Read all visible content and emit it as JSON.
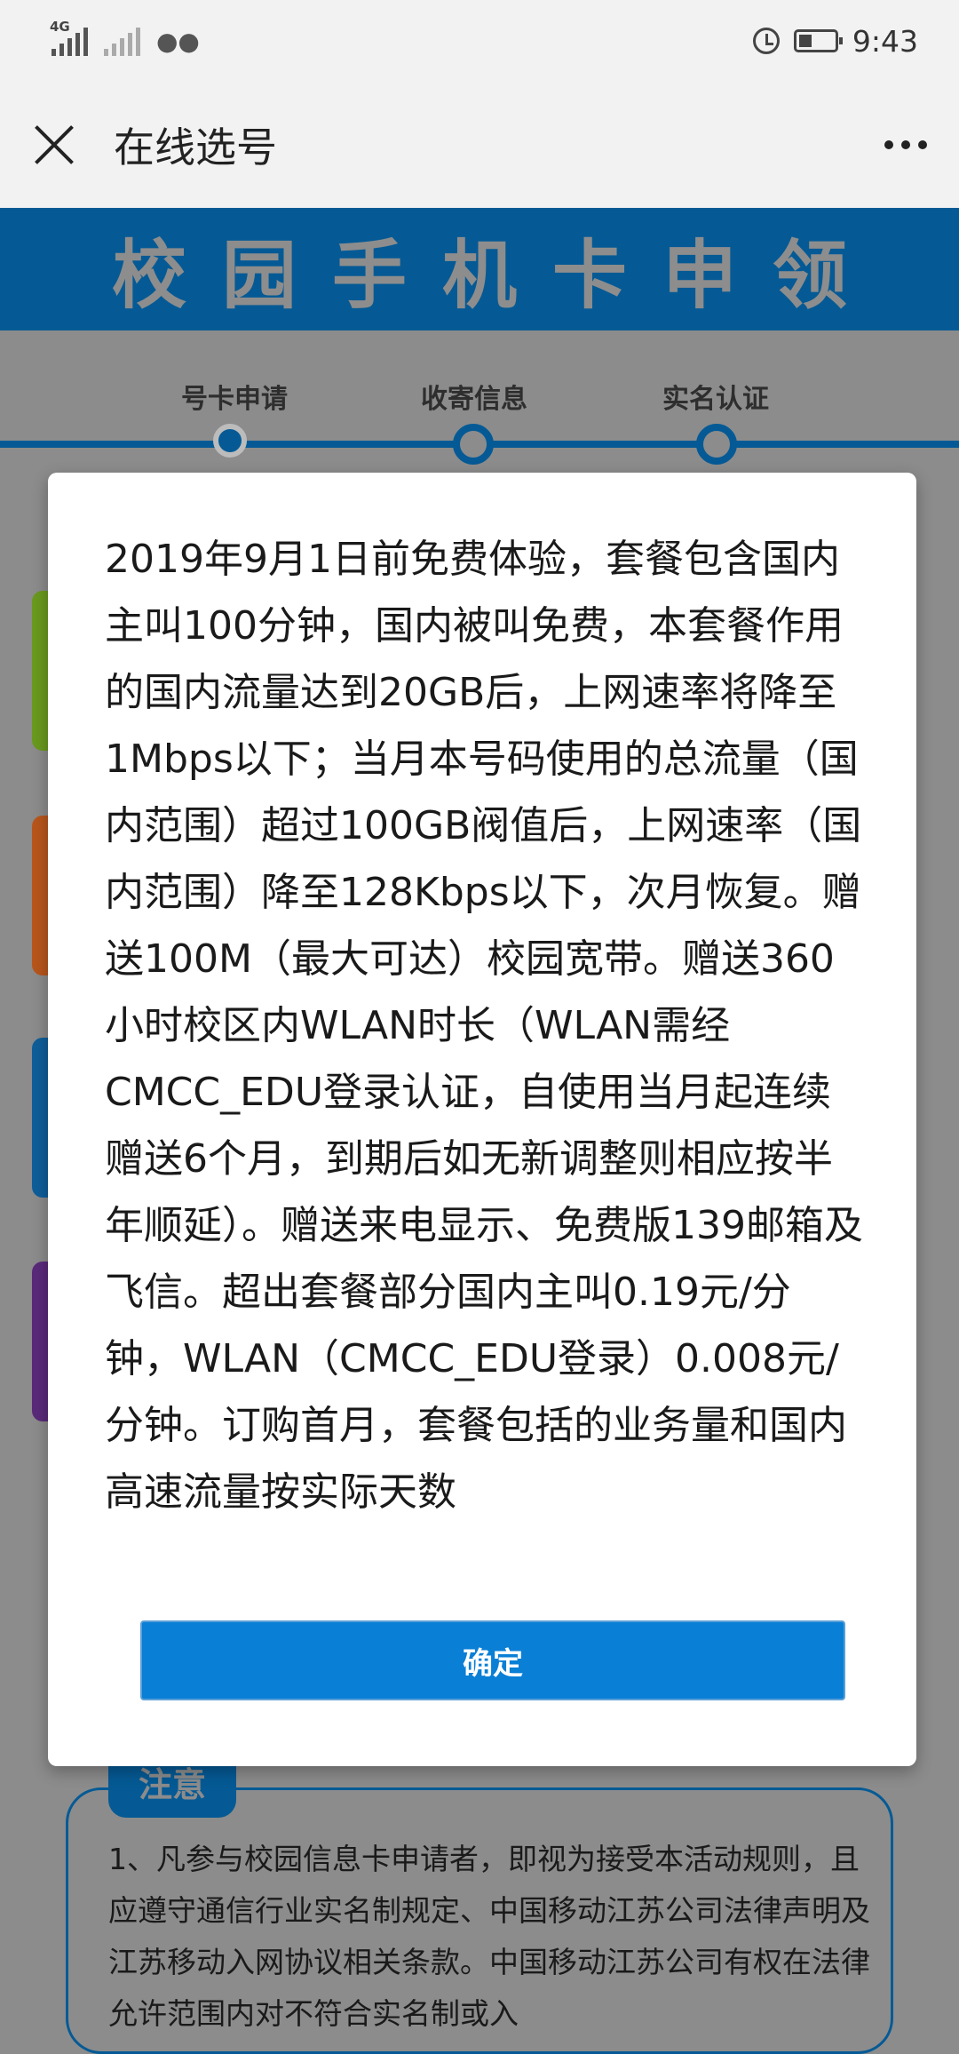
{
  "status_bar": {
    "network_label": "4G",
    "time": "9:43",
    "icons": [
      "signal-icon",
      "signal-icon",
      "wechat-icon",
      "alarm-icon",
      "battery-icon"
    ]
  },
  "nav": {
    "title": "在线选号",
    "close_icon": "close-icon",
    "more_icon": "more-icon"
  },
  "banner": {
    "title": "校园手机卡申领"
  },
  "steps": [
    {
      "label": "号卡申请",
      "active": true
    },
    {
      "label": "收寄信息",
      "active": false
    },
    {
      "label": "实名认证",
      "active": false
    }
  ],
  "dialog": {
    "content": "2019年9月1日前免费体验，套餐包含国内主叫100分钟，国内被叫免费，本套餐作用的国内流量达到20GB后，上网速率将降至1Mbps以下；当月本号码使用的总流量（国内范围）超过100GB阀值后，上网速率（国内范围）降至128Kbps以下，次月恢复。赠送100M（最大可达）校园宽带。赠送360小时校区内WLAN时长（WLAN需经CMCC_EDU登录认证，自使用当月起连续赠送6个月，到期后如无新调整则相应按半年顺延）。赠送来电显示、免费版139邮箱及飞信。超出套餐部分国内主叫0.19元/分钟，WLAN（CMCC_EDU登录）0.008元/分钟。订购首月，套餐包括的业务量和国内高速流量按实际天数",
    "confirm_label": "确定"
  },
  "notice": {
    "tag": "注意",
    "text": "1、凡参与校园信息卡申请者，即视为接受本活动规则，且应遵守通信行业实名制规定、中国移动江苏公司法律声明及江苏移动入网协议相关条款。中国移动江苏公司有权在法律允许范围内对不符合实名制或入"
  },
  "colors": {
    "brand_blue": "#055a95",
    "button_blue": "#0a7fd6",
    "card_green": "#6a9a1e",
    "card_orange": "#b8561c",
    "card_blue": "#0f5e9a",
    "card_purple": "#5a2a7a"
  }
}
